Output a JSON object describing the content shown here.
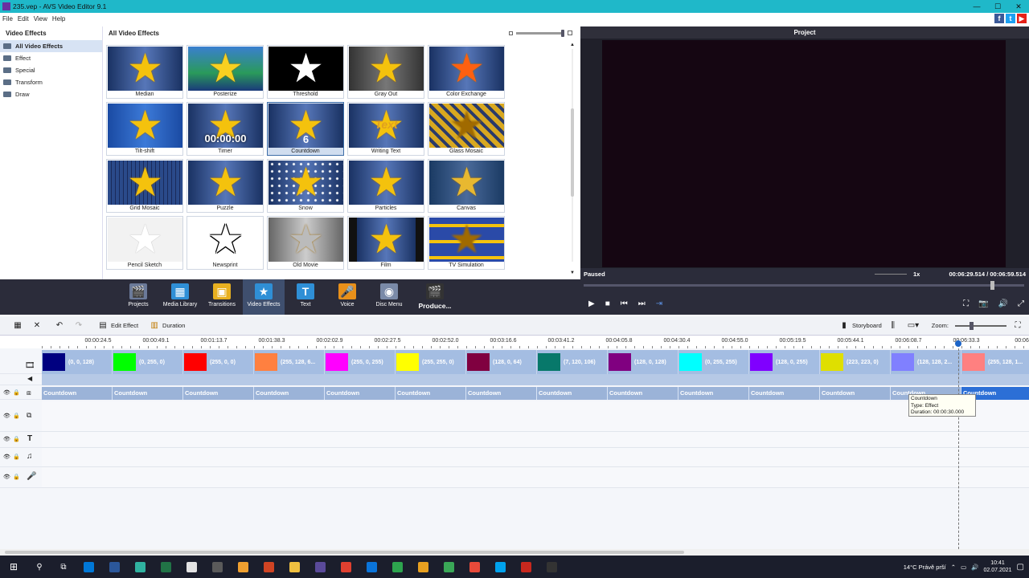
{
  "window": {
    "title": "235.vep - AVS Video Editor 9.1",
    "minimize": "—",
    "maximize": "☐",
    "close": "✕"
  },
  "menu": [
    "File",
    "Edit",
    "View",
    "Help"
  ],
  "social": [
    {
      "label": "f",
      "color": "#3b5998"
    },
    {
      "label": "t",
      "color": "#1da1f2"
    },
    {
      "label": "▶",
      "color": "#e62117"
    }
  ],
  "left_panel": {
    "title": "Video Effects",
    "items": [
      "All Video Effects",
      "Effect",
      "Special",
      "Transform",
      "Draw"
    ]
  },
  "gallery": {
    "title": "All Video Effects",
    "tiles": [
      {
        "label": "Median",
        "style": "median"
      },
      {
        "label": "Posterize",
        "style": "posterize"
      },
      {
        "label": "Threshold",
        "style": "threshold"
      },
      {
        "label": "Gray Out",
        "style": "grayout"
      },
      {
        "label": "Color Exchange",
        "style": "colorexchange"
      },
      {
        "label": "Tilt-shift",
        "style": "tiltshift"
      },
      {
        "label": "Timer",
        "style": "timer",
        "overlay": "00:00:00"
      },
      {
        "label": "Countdown",
        "style": "countdown",
        "overlay": "6",
        "selected": true
      },
      {
        "label": "Writing Text",
        "style": "writing",
        "overlay": "Text"
      },
      {
        "label": "Glass Mosaic",
        "style": "glass"
      },
      {
        "label": "Grid Mosaic",
        "style": "grid"
      },
      {
        "label": "Puzzle",
        "style": "puzzle"
      },
      {
        "label": "Snow",
        "style": "snow"
      },
      {
        "label": "Particles",
        "style": "particles"
      },
      {
        "label": "Canvas",
        "style": "canvas"
      },
      {
        "label": "Pencil Sketch",
        "style": "pencil"
      },
      {
        "label": "Newsprint",
        "style": "newsprint"
      },
      {
        "label": "Old Movie",
        "style": "oldmovie"
      },
      {
        "label": "Film",
        "style": "film"
      },
      {
        "label": "TV Simulation",
        "style": "tv"
      }
    ]
  },
  "project": {
    "title": "Project",
    "status": "Paused",
    "speed": "1x",
    "time_current": "00:06:29.514",
    "time_sep": "/",
    "time_total": "00:06:59.514",
    "seek_fraction": 0.928
  },
  "toolbar": [
    {
      "label": "Projects",
      "icon": "clapper-icon",
      "glyph": "🎬",
      "color": "#6b7a99"
    },
    {
      "label": "Media Library",
      "icon": "media-library-icon",
      "glyph": "▦",
      "color": "#2f8fd6"
    },
    {
      "label": "Transitions",
      "icon": "transitions-icon",
      "glyph": "▣",
      "color": "#e8b020"
    },
    {
      "label": "Video Effects",
      "icon": "video-effects-icon",
      "glyph": "★",
      "color": "#2f8fd6",
      "active": true
    },
    {
      "label": "Text",
      "icon": "text-icon",
      "glyph": "T",
      "color": "#2f8fd6"
    },
    {
      "label": "Voice",
      "icon": "microphone-icon",
      "glyph": "🎤",
      "color": "#e8901a"
    },
    {
      "label": "Disc Menu",
      "icon": "disc-icon",
      "glyph": "◉",
      "color": "#7a8aa8"
    }
  ],
  "produce_label": "Produce...",
  "timeline_bar": {
    "edit_effect": "Edit Effect",
    "duration": "Duration",
    "storyboard": "Storyboard",
    "zoom": "Zoom:"
  },
  "ruler": [
    "00:00:24.5",
    "00:00:49.1",
    "00:01:13.7",
    "00:01:38.3",
    "00:02:02.9",
    "00:02:27.5",
    "00:02:52.0",
    "00:03:16.6",
    "00:03:41.2",
    "00:04:05.8",
    "00:04:30.4",
    "00:04:55.0",
    "00:05:19.5",
    "00:05:44.1",
    "00:06:08.7",
    "00:06:33.3",
    "00:06:5"
  ],
  "clips": [
    {
      "color": "#000080",
      "label": "(0, 0, 128)"
    },
    {
      "color": "#00ff00",
      "label": "(0, 255, 0)"
    },
    {
      "color": "#ff0000",
      "label": "(255, 0, 0)"
    },
    {
      "color": "#ff8040",
      "label": "(255, 128, 6..."
    },
    {
      "color": "#ff00ff",
      "label": "(255, 0, 255)"
    },
    {
      "color": "#ffff00",
      "label": "(255, 255, 0)"
    },
    {
      "color": "#800040",
      "label": "(128, 0, 64)"
    },
    {
      "color": "#07786a",
      "label": "(7, 120, 106)"
    },
    {
      "color": "#800080",
      "label": "(128, 0, 128)"
    },
    {
      "color": "#00ffff",
      "label": "(0, 255, 255)"
    },
    {
      "color": "#8000ff",
      "label": "(128, 0, 255)"
    },
    {
      "color": "#dfdf00",
      "label": "(223, 223, 0)"
    },
    {
      "color": "#8080ff",
      "label": "(128, 128, 2..."
    },
    {
      "color": "#ff8080",
      "label": "(255, 128, 1..."
    }
  ],
  "effects": [
    "Countdown",
    "Countdown",
    "Countdown",
    "Countdown",
    "Countdown",
    "Countdown",
    "Countdown",
    "Countdown",
    "Countdown",
    "Countdown",
    "Countdown",
    "Countdown",
    "Countdown",
    "Countdown"
  ],
  "tooltip": {
    "line1": "Countdown",
    "line2": "Type: Effect",
    "line3": "Duration: 00:00:30.000"
  },
  "taskbar": {
    "apps": [
      "#0078d7",
      "#2b579a",
      "#30b2a0",
      "#217346",
      "#e3e3e3",
      "#5a5a5a",
      "#f0a030",
      "#d04423",
      "#f0c040",
      "#5a4a9a",
      "#e04030",
      "#0a74da",
      "#2da44e",
      "#e8a020",
      "#3aa757",
      "#e84a3a",
      "#00a2ed",
      "#c8281e",
      "#333333"
    ],
    "weather": "14°C  Právě prší",
    "time": "10:41",
    "date": "02.07.2021"
  }
}
